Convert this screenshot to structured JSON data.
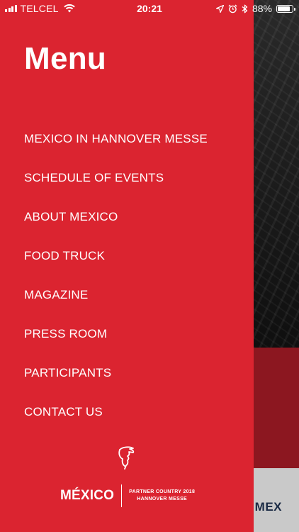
{
  "status_bar": {
    "carrier": "TELCEL",
    "time": "20:21",
    "battery": "88%",
    "battery_level": 0.88
  },
  "menu": {
    "title": "Menu",
    "items": [
      {
        "label": "MEXICO IN HANNOVER MESSE"
      },
      {
        "label": "SCHEDULE OF EVENTS"
      },
      {
        "label": "ABOUT MEXICO"
      },
      {
        "label": "FOOD TRUCK"
      },
      {
        "label": "MAGAZINE"
      },
      {
        "label": "PRESS ROOM"
      },
      {
        "label": "PARTICIPANTS"
      },
      {
        "label": "CONTACT US"
      }
    ]
  },
  "logo": {
    "brand": "MÉXICO",
    "partner_line1": "PARTNER COUNTRY 2018",
    "partner_line2": "HANNOVER MESSE"
  },
  "background": {
    "gray_label": "MEX"
  },
  "colors": {
    "drawer": "#db2430",
    "background_red": "#8c1720",
    "background_gray": "#c9c9c9"
  }
}
